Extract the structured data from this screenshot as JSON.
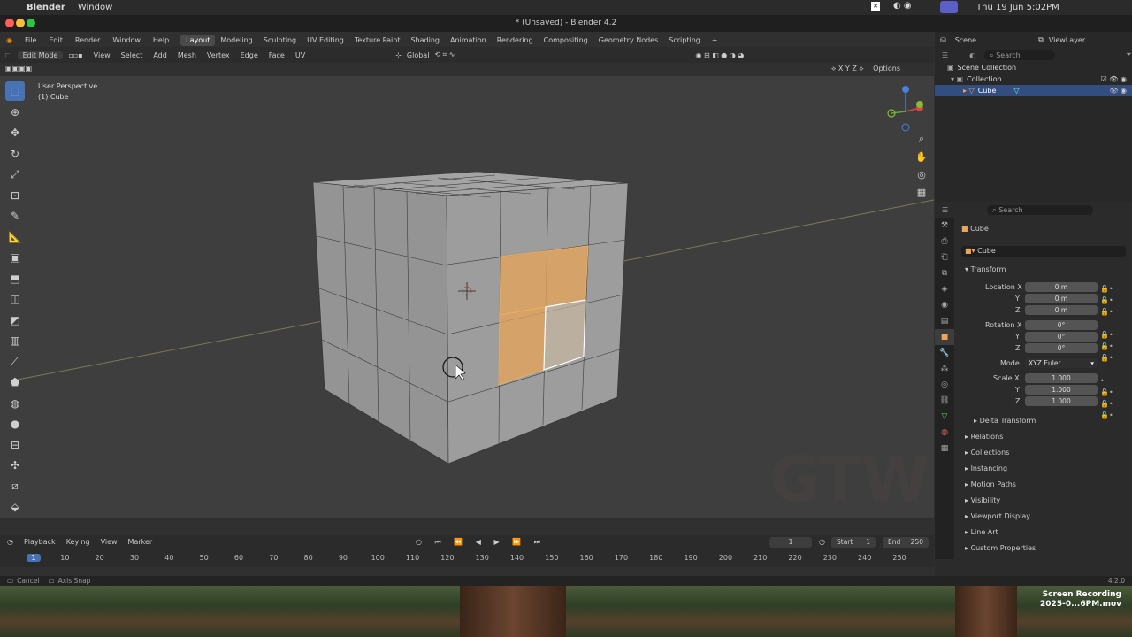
{
  "menubar": {
    "app": "Blender",
    "menu": "Window",
    "title": "* (Unsaved) - Blender 4.2",
    "datetime": "Thu 19 Jun  5:02PM"
  },
  "topbar": {
    "menus": [
      "File",
      "Edit",
      "Render",
      "Window",
      "Help"
    ],
    "workspaces": [
      "Layout",
      "Modeling",
      "Sculpting",
      "UV Editing",
      "Texture Paint",
      "Shading",
      "Animation",
      "Rendering",
      "Compositing",
      "Geometry Nodes",
      "Scripting"
    ],
    "active": "Layout",
    "add": "+",
    "scene": "Scene",
    "viewlayer": "ViewLayer"
  },
  "viewport_header": {
    "mode": "Edit Mode",
    "menus": [
      "View",
      "Select",
      "Add",
      "Mesh",
      "Vertex",
      "Edge",
      "Face",
      "UV"
    ],
    "orientation": "Global",
    "options": "Options",
    "axes": [
      "X",
      "Y",
      "Z"
    ]
  },
  "viewport": {
    "perspective": "User Perspective",
    "object": "(1) Cube"
  },
  "outliner": {
    "search": "Search",
    "root": "Scene Collection",
    "collection": "Collection",
    "object": "Cube"
  },
  "properties": {
    "search": "Search",
    "object_name": "Cube",
    "data_name": "Cube",
    "transform": "Transform",
    "location_label": "Location X",
    "loc_y_label": "Y",
    "loc_z_label": "Z",
    "location": [
      "0 m",
      "0 m",
      "0 m"
    ],
    "rotation_label": "Rotation X",
    "rot_y_label": "Y",
    "rot_z_label": "Z",
    "rotation": [
      "0°",
      "0°",
      "0°"
    ],
    "mode_label": "Mode",
    "mode": "XYZ Euler",
    "scale_label": "Scale X",
    "sc_y_label": "Y",
    "sc_z_label": "Z",
    "scale": [
      "1.000",
      "1.000",
      "1.000"
    ],
    "delta": "Delta Transform",
    "sections": [
      "Relations",
      "Collections",
      "Instancing",
      "Motion Paths",
      "Visibility",
      "Viewport Display",
      "Line Art",
      "Custom Properties"
    ]
  },
  "timeline": {
    "menus": [
      "Playback",
      "Keying",
      "View",
      "Marker"
    ],
    "current": "1",
    "start_label": "Start",
    "start": "1",
    "end_label": "End",
    "end": "250",
    "ticks": [
      "1",
      "10",
      "20",
      "30",
      "40",
      "50",
      "60",
      "70",
      "80",
      "90",
      "100",
      "110",
      "120",
      "130",
      "140",
      "150",
      "160",
      "170",
      "180",
      "190",
      "200",
      "210",
      "220",
      "230",
      "240",
      "250"
    ]
  },
  "statusbar": {
    "cancel": "Cancel",
    "snap": "Axis Snap",
    "version": "4.2.0"
  },
  "recording": {
    "line1": "Screen Recording",
    "line2": "2025-0...6PM.mov"
  },
  "colors": {
    "accent": "#4772b3",
    "selection": "#e8a65a",
    "active_face": "#ffffff"
  }
}
